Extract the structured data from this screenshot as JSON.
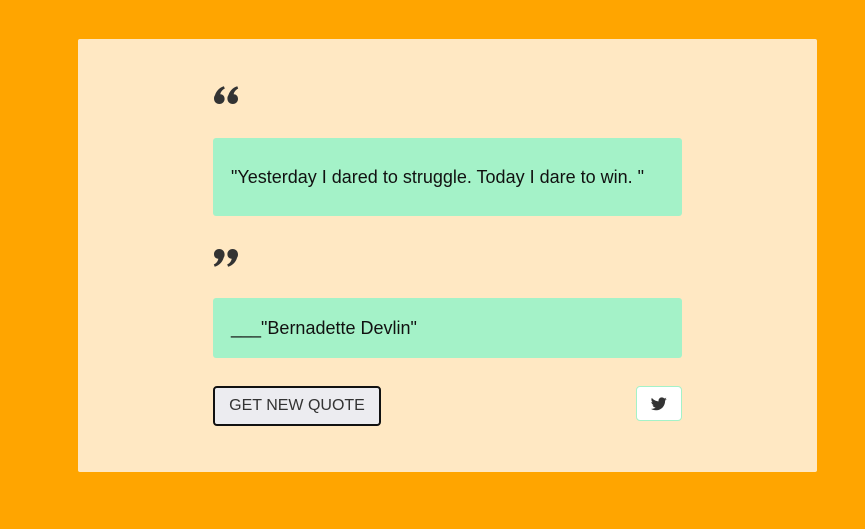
{
  "quote": {
    "text": "\"Yesterday I dared to struggle. Today I dare to win. \"",
    "author": "___\"Bernadette Devlin\""
  },
  "actions": {
    "new_quote_label": "GET NEW QUOTE",
    "tweet_icon": "twitter-icon"
  },
  "icons": {
    "open_quote": "quote-left-icon",
    "close_quote": "quote-right-icon"
  },
  "colors": {
    "background": "#ffa500",
    "card": "#ffe8c3",
    "quote_box": "#a4f2c8",
    "icon": "#333333"
  }
}
